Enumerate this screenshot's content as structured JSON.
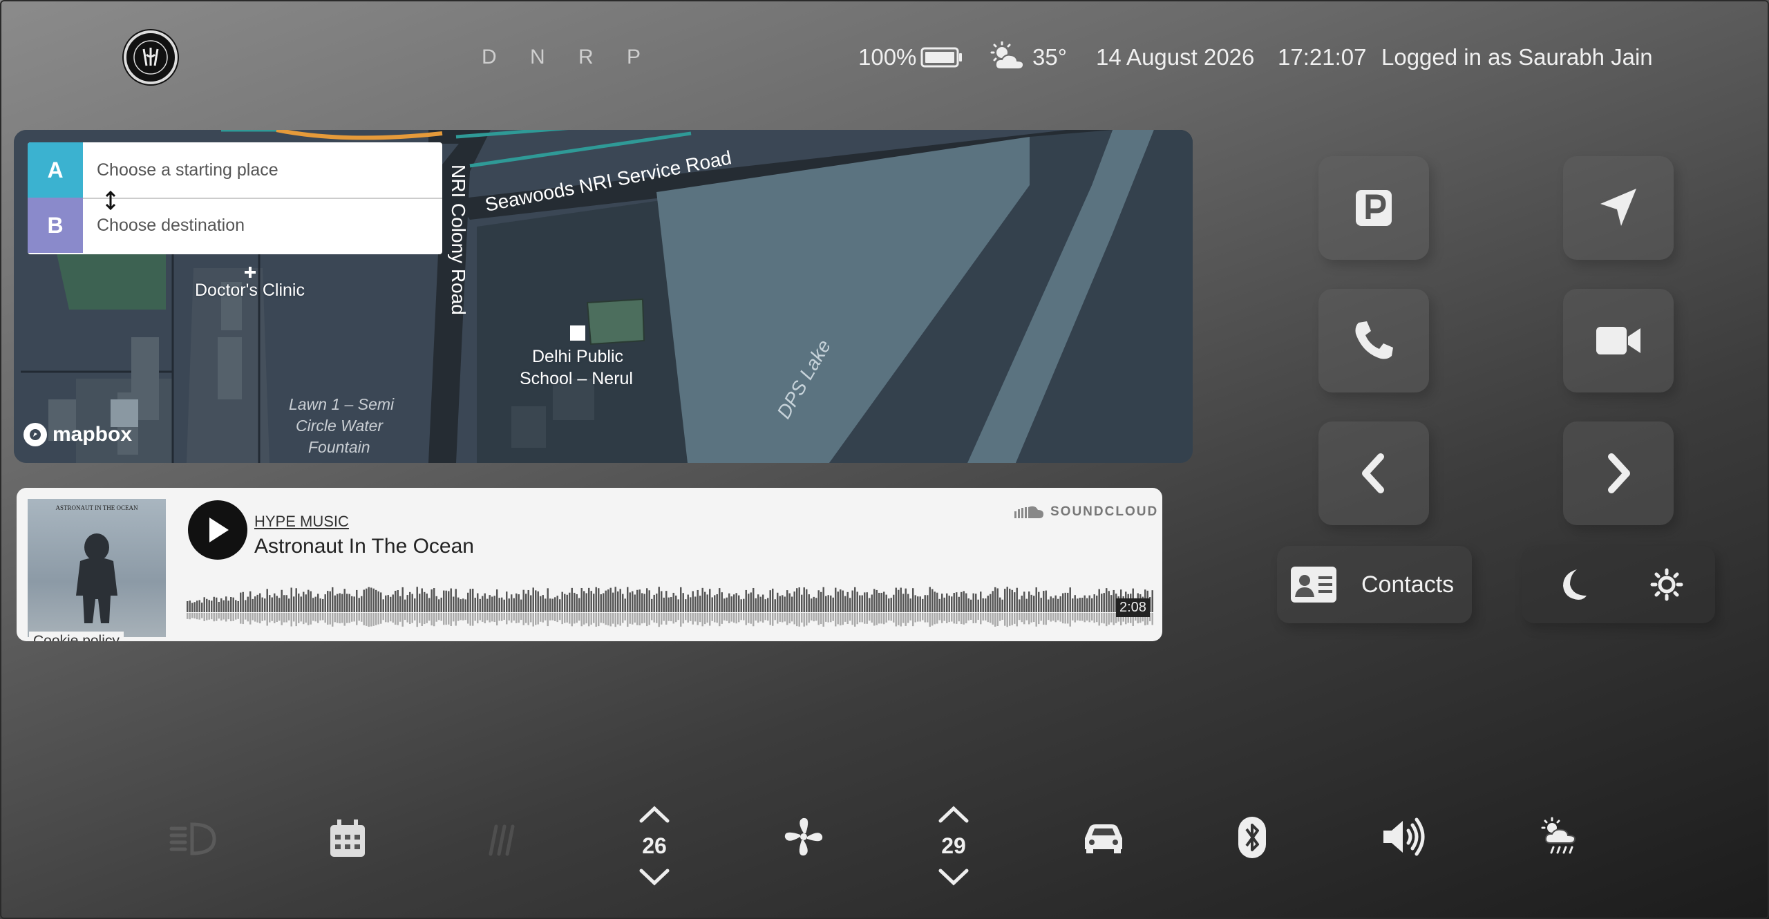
{
  "header": {
    "gears": "D N R P",
    "battery": "100%",
    "temperature": "35°",
    "date": "14 August 2026",
    "time": "17:21:07",
    "user": "Logged in as Saurabh Jain"
  },
  "map": {
    "start_letter": "A",
    "start_placeholder": "Choose a starting place",
    "dest_letter": "B",
    "dest_placeholder": "Choose destination",
    "labels": {
      "road1": "Seawoods NRI Service Road",
      "road2": "NRI Colony Road",
      "clinic": "Doctor's Clinic",
      "school_line1": "Delhi Public",
      "school_line2": "School – Nerul",
      "lake": "DPS Lake",
      "lawn_line1": "Lawn 1 – Semi",
      "lawn_line2": "Circle Water",
      "lawn_line3": "Fountain"
    },
    "attribution": "mapbox",
    "colors": {
      "start": "#3bb2d0",
      "dest": "#8a8acb"
    }
  },
  "music": {
    "cover_title": "ASTRONAUT IN THE OCEAN",
    "cookie": "Cookie policy",
    "artist": "HYPE MUSIC",
    "track": "Astronaut In The Ocean",
    "provider": "SOUNDCLOUD",
    "duration": "2:08"
  },
  "controls": {
    "parking": "parking-icon",
    "navigate": "location-arrow-icon",
    "call": "phone-icon",
    "video": "video-icon",
    "prev": "chevron-left-icon",
    "next": "chevron-right-icon",
    "contacts_label": "Contacts"
  },
  "bottom": {
    "temp_left": "26",
    "temp_right": "29"
  }
}
